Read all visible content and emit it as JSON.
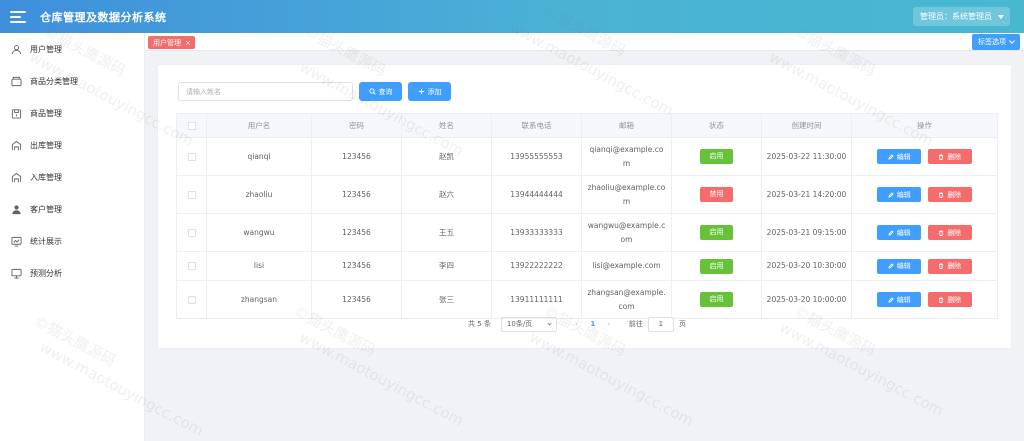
{
  "header": {
    "title": "仓库管理及数据分析系统",
    "admin_label": "管理员：系统管理员"
  },
  "sidebar": {
    "items": [
      {
        "label": "用户管理",
        "icon": "user-icon"
      },
      {
        "label": "商品分类管理",
        "icon": "box-icon"
      },
      {
        "label": "商品管理",
        "icon": "package-icon"
      },
      {
        "label": "出库管理",
        "icon": "warehouse-out-icon"
      },
      {
        "label": "入库管理",
        "icon": "warehouse-in-icon"
      },
      {
        "label": "客户管理",
        "icon": "person-icon"
      },
      {
        "label": "统计展示",
        "icon": "chart-icon"
      },
      {
        "label": "预测分析",
        "icon": "monitor-icon"
      }
    ]
  },
  "tabs": {
    "active": "用户管理",
    "close": "×",
    "options_label": "标签选项"
  },
  "toolbar": {
    "search_placeholder": "请输入姓名",
    "search_value": "",
    "query_label": "查询",
    "add_label": "添加"
  },
  "table": {
    "columns": [
      "用户名",
      "密码",
      "姓名",
      "联系电话",
      "邮箱",
      "状态",
      "创建时间",
      "操作"
    ],
    "edit_label": "编辑",
    "delete_label": "删除",
    "rows": [
      {
        "username": "qianqi",
        "password": "123456",
        "name": "赵凯",
        "phone": "13955555553",
        "email": "qianqi@example.com",
        "status": "启用",
        "status_type": "on",
        "created": "2025-03-22 11:30:00"
      },
      {
        "username": "zhaoliu",
        "password": "123456",
        "name": "赵六",
        "phone": "13944444444",
        "email": "zhaoliu@example.com",
        "status": "禁用",
        "status_type": "off",
        "created": "2025-03-21 14:20:00"
      },
      {
        "username": "wangwu",
        "password": "123456",
        "name": "王五",
        "phone": "13933333333",
        "email": "wangwu@example.com",
        "status": "启用",
        "status_type": "on",
        "created": "2025-03-21 09:15:00"
      },
      {
        "username": "lisi",
        "password": "123456",
        "name": "李四",
        "phone": "13922222222",
        "email": "lisi@example.com",
        "status": "启用",
        "status_type": "on",
        "created": "2025-03-20 10:30:00"
      },
      {
        "username": "zhangsan",
        "password": "123456",
        "name": "张三",
        "phone": "13911111111",
        "email": "zhangsan@example.com",
        "status": "启用",
        "status_type": "on",
        "created": "2025-03-20 10:00:00"
      }
    ]
  },
  "pagination": {
    "total": "共 5 条",
    "page_size": "10条/页",
    "prev": "‹",
    "next": "›",
    "current_page": "1",
    "goto_label": "前往",
    "goto_value": "1",
    "page_unit": "页"
  },
  "watermark": {
    "brand": "©猫头鹰源码",
    "site": "www.maotouyingcc.com"
  },
  "colors": {
    "primary": "#409eff",
    "success": "#67c23a",
    "danger": "#f56c6c"
  }
}
